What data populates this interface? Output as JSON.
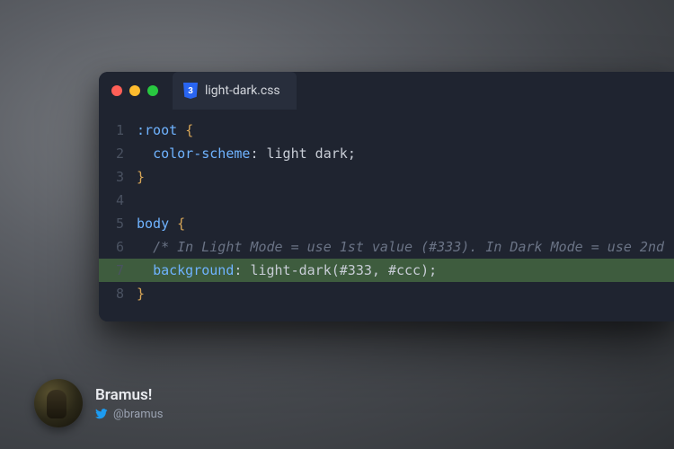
{
  "tab": {
    "filename": "light-dark.css"
  },
  "code": {
    "lines": [
      {
        "n": 1,
        "hl": false,
        "segs": [
          [
            ":root ",
            "sel"
          ],
          [
            "{",
            "brace"
          ]
        ]
      },
      {
        "n": 2,
        "hl": false,
        "segs": [
          [
            "  ",
            ""
          ],
          [
            "color-scheme",
            "prop"
          ],
          [
            ": ",
            "punc"
          ],
          [
            "light dark",
            "val"
          ],
          [
            ";",
            "punc"
          ]
        ]
      },
      {
        "n": 3,
        "hl": false,
        "segs": [
          [
            "}",
            "brace"
          ]
        ]
      },
      {
        "n": 4,
        "hl": false,
        "segs": []
      },
      {
        "n": 5,
        "hl": false,
        "segs": [
          [
            "body ",
            "sel"
          ],
          [
            "{",
            "brace"
          ]
        ]
      },
      {
        "n": 6,
        "hl": false,
        "segs": [
          [
            "  ",
            ""
          ],
          [
            "/* In Light Mode = use 1st value (#333). In Dark Mode = use 2nd",
            "com"
          ]
        ]
      },
      {
        "n": 7,
        "hl": true,
        "segs": [
          [
            "  ",
            ""
          ],
          [
            "background",
            "prop"
          ],
          [
            ": ",
            "punc"
          ],
          [
            "light-dark",
            "fn"
          ],
          [
            "(",
            "punc"
          ],
          [
            "#333",
            "num"
          ],
          [
            ", ",
            "punc"
          ],
          [
            "#ccc",
            "num"
          ],
          [
            ")",
            "punc"
          ],
          [
            ";",
            "punc"
          ]
        ]
      },
      {
        "n": 8,
        "hl": false,
        "segs": [
          [
            "}",
            "brace"
          ]
        ]
      }
    ]
  },
  "author": {
    "name": "Bramus!",
    "handle": "@bramus"
  }
}
